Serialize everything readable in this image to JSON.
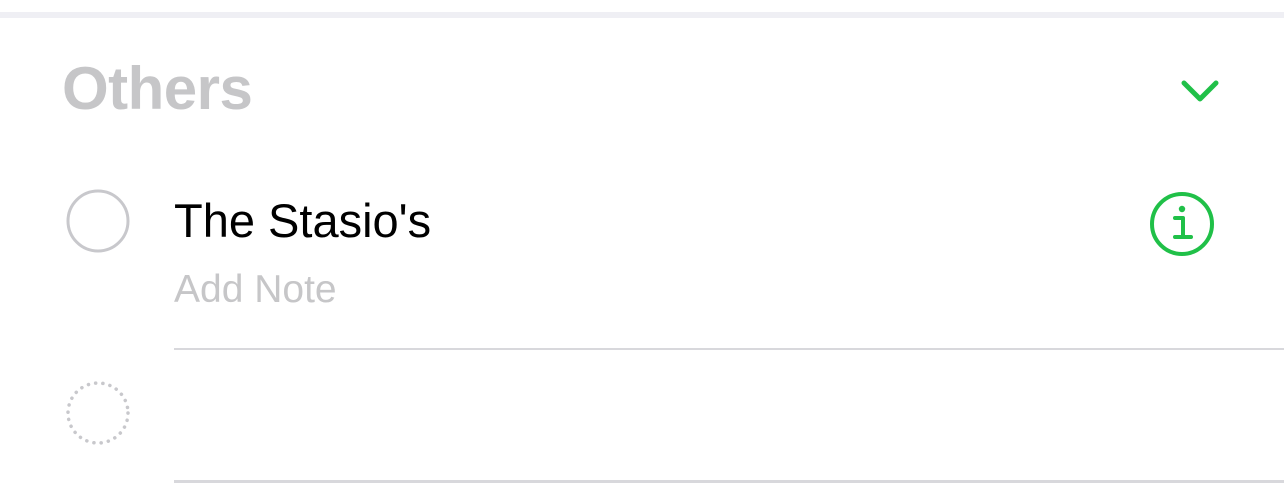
{
  "section": {
    "title": "Others"
  },
  "colors": {
    "accent": "#20c048",
    "section_title": "#c6c6c8",
    "placeholder": "#c6c6c8",
    "circle": "#c8c8cc",
    "divider": "#d8d8dc"
  },
  "icons": {
    "collapse": "chevron-down-icon",
    "info": "info-icon",
    "checkbox": "empty-circle-icon",
    "new_item": "dotted-circle-icon"
  },
  "reminders": [
    {
      "title": "The Stasio's",
      "note_placeholder": "Add Note",
      "completed": false
    }
  ]
}
